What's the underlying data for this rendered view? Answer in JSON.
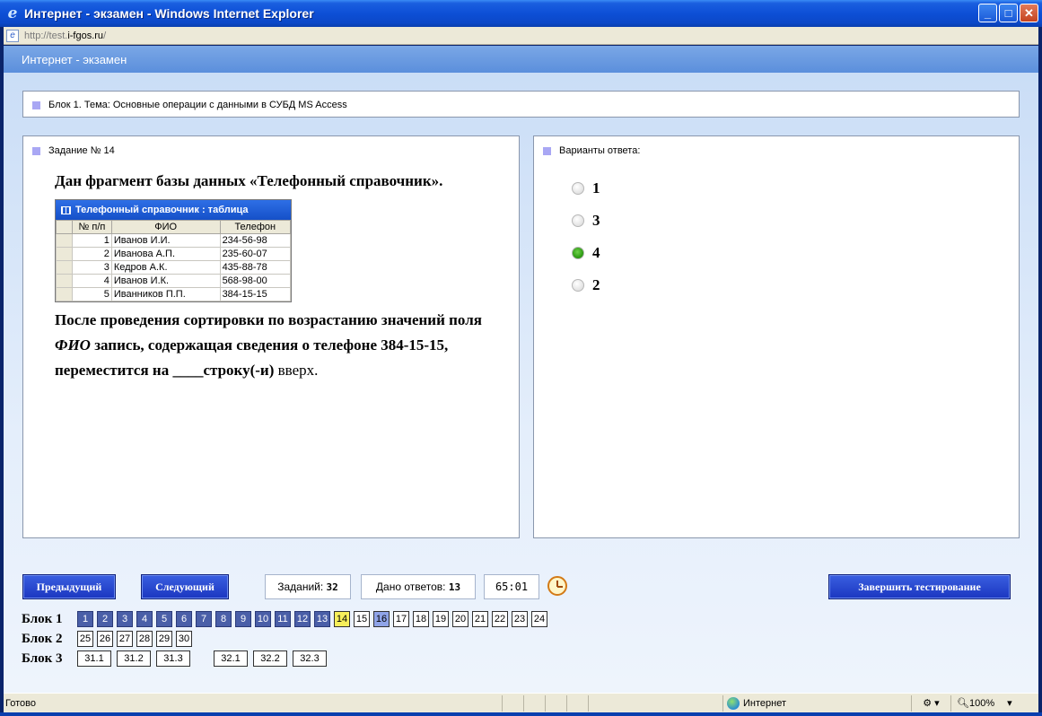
{
  "window": {
    "title": "Интернет - экзамен - Windows Internet Explorer",
    "url_prefix": "http://test.",
    "url_domain": "i-fgos.ru",
    "url_suffix": "/"
  },
  "app": {
    "header": "Интернет - экзамен",
    "block_topic": "Блок 1. Тема: Основные операции с данными в СУБД MS Access"
  },
  "task": {
    "header": "Задание № 14",
    "intro": "Дан фрагмент базы данных «Телефонный справочник».",
    "question_a": "После проведения сортировки по возрастанию значений поля ",
    "question_field": "ФИО",
    "question_b": " запись, содержащая сведения о телефоне 384-15-15, переместится на ____строку(-и) ",
    "question_c": "вверх.",
    "table": {
      "title": "Телефонный справочник : таблица",
      "columns": [
        "№ п/п",
        "ФИО",
        "Телефон"
      ],
      "rows": [
        [
          "1",
          "Иванов И.И.",
          "234-56-98"
        ],
        [
          "2",
          "Иванова А.П.",
          "235-60-07"
        ],
        [
          "3",
          "Кедров А.К.",
          "435-88-78"
        ],
        [
          "4",
          "Иванов И.К.",
          "568-98-00"
        ],
        [
          "5",
          "Иванников П.П.",
          "384-15-15"
        ]
      ]
    }
  },
  "answers": {
    "header": "Варианты ответа:",
    "options": [
      {
        "label": "1",
        "selected": false
      },
      {
        "label": "3",
        "selected": false
      },
      {
        "label": "4",
        "selected": true
      },
      {
        "label": "2",
        "selected": false
      }
    ]
  },
  "controls": {
    "prev_label": "Предыдущий",
    "next_label": "Следующий",
    "tasks_label": "Заданий:",
    "tasks_value": "32",
    "answered_label": "Дано ответов:",
    "answered_value": "13",
    "timer": "65:01",
    "finish_label": "Завершить тестирование"
  },
  "navigation": {
    "block1_label": "Блок 1",
    "block2_label": "Блок 2",
    "block3_label": "Блок 3",
    "block1": [
      "1",
      "2",
      "3",
      "4",
      "5",
      "6",
      "7",
      "8",
      "9",
      "10",
      "11",
      "12",
      "13",
      "14",
      "15",
      "16",
      "17",
      "18",
      "19",
      "20",
      "21",
      "22",
      "23",
      "24"
    ],
    "block1_states": [
      "done",
      "done",
      "done",
      "done",
      "done",
      "done",
      "done",
      "done",
      "done",
      "done",
      "done",
      "done",
      "done",
      "current",
      "",
      "marked",
      "",
      "",
      "",
      "",
      "",
      "",
      "",
      ""
    ],
    "block2": [
      "25",
      "26",
      "27",
      "28",
      "29",
      "30"
    ],
    "block3a": [
      "31.1",
      "31.2",
      "31.3"
    ],
    "block3b": [
      "32.1",
      "32.2",
      "32.3"
    ]
  },
  "status": {
    "left": "Готово",
    "zone": "Интернет",
    "zoom": "100%"
  },
  "colors": {
    "accent_bullet": "#a9a7f4",
    "button": "#1b36c0",
    "answered_box": "#4a5fa8",
    "current_box": "#f7ef5a",
    "selected_radio": "#2c9a12"
  }
}
